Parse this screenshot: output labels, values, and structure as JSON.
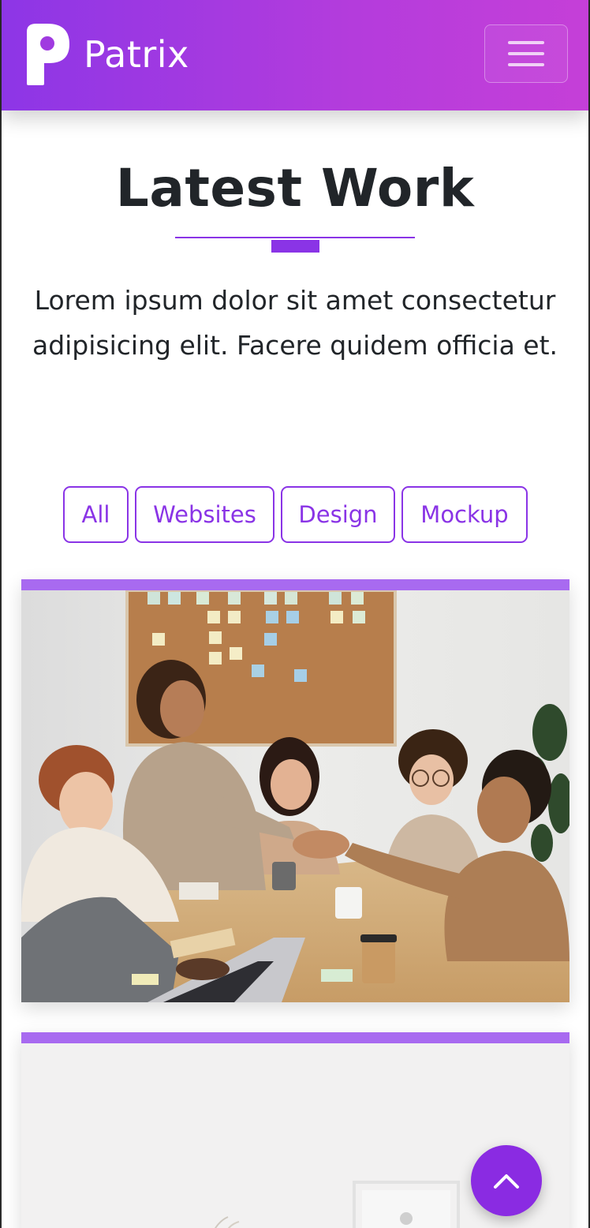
{
  "navbar": {
    "brand_name": "Patrix",
    "logo_icon": "patrix-p-logo-icon",
    "menu_icon": "hamburger-menu-icon",
    "gradient": [
      "#8d36e6",
      "#c53fd8"
    ]
  },
  "section": {
    "title": "Latest Work",
    "lead": "Lorem ipsum dolor sit amet consectetur adipisicing elit. Facere quidem officia et.",
    "accent": "#8a34e6"
  },
  "filters": {
    "items": [
      {
        "label": "All"
      },
      {
        "label": "Websites"
      },
      {
        "label": "Design"
      },
      {
        "label": "Mockup"
      }
    ]
  },
  "portfolio": {
    "items": [
      {
        "image": "team-meeting-handshake-photo"
      },
      {
        "image": "white-desk-frame-photo"
      }
    ],
    "bar_color": "#a86af0"
  },
  "back_to_top": {
    "icon": "chevron-up-icon",
    "color": "#8a2be2"
  }
}
